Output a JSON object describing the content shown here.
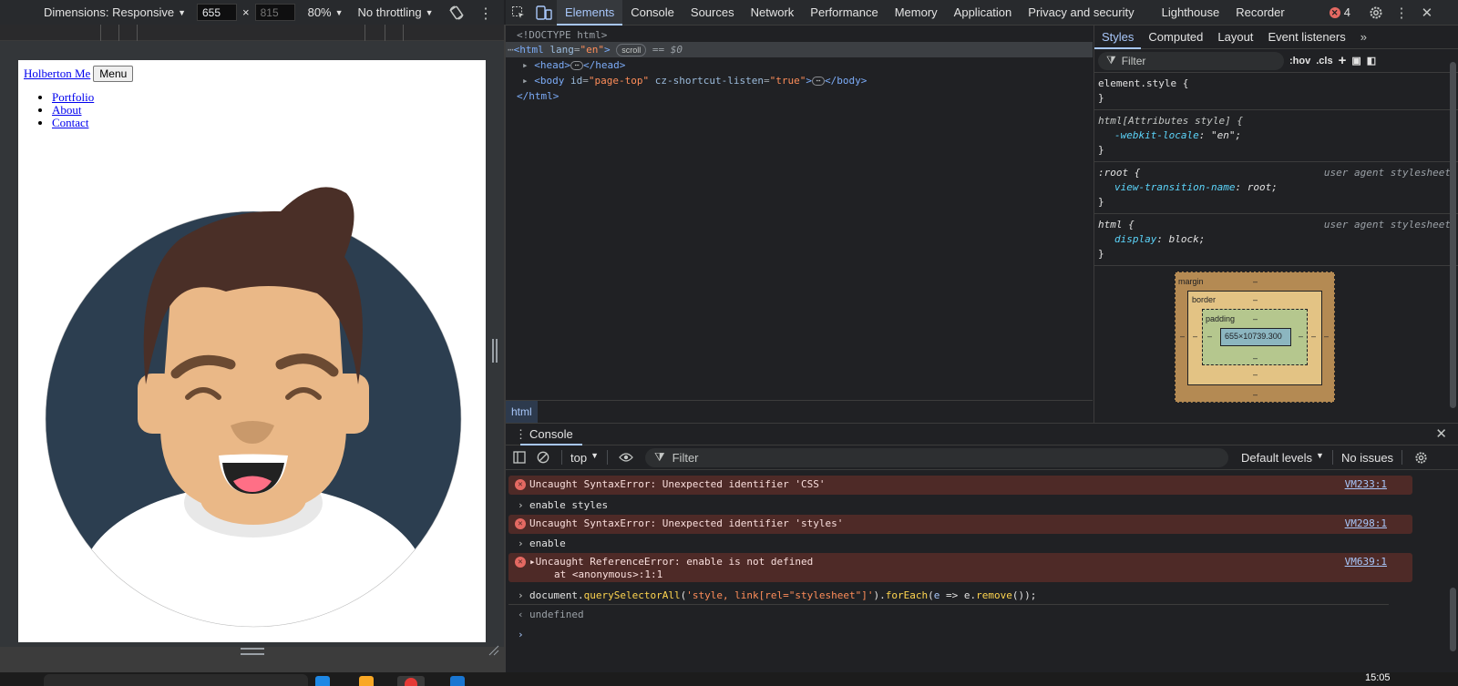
{
  "device_toolbar": {
    "dimensions_label": "Dimensions: Responsive",
    "width": "655",
    "height_placeholder": "815",
    "times": "×",
    "zoom": "80%",
    "throttling": "No throttling"
  },
  "site": {
    "brand_link": "Holberton Me",
    "menu_button": "Menu",
    "nav": [
      "Portfolio",
      "About",
      "Contact"
    ]
  },
  "devtools_tabs": [
    "Elements",
    "Console",
    "Sources",
    "Network",
    "Performance",
    "Memory",
    "Application",
    "Privacy and security",
    "Lighthouse",
    "Recorder"
  ],
  "error_count": "4",
  "elements": {
    "doctype": "<!DOCTYPE html>",
    "html_open_tag": "<html",
    "html_lang_attr": "lang",
    "html_lang_val": "\"en\"",
    "scroll_pill": "scroll",
    "eq_ref": "== $0",
    "head_open": "<head>",
    "head_close": "</head>",
    "body_open": "<body",
    "body_id_attr": "id",
    "body_id_val": "\"page-top\"",
    "body_cz_attr": "cz-shortcut-listen",
    "body_cz_val": "\"true\"",
    "body_close": "</body>",
    "html_close": "</html>",
    "breadcrumb": "html"
  },
  "styles_tabs": [
    "Styles",
    "Computed",
    "Layout",
    "Event listeners"
  ],
  "styles_filter_placeholder": "Filter",
  "hov_label": ":hov",
  "cls_label": ".cls",
  "rules": {
    "r1_selector": "element.style {",
    "r2_selector": "html[Attributes style] {",
    "r2_prop": "-webkit-locale",
    "r2_val": "\"en\";",
    "r3_selector": ":root {",
    "r3_source": "user agent stylesheet",
    "r3_prop": "view-transition-name",
    "r3_val": "root;",
    "r4_selector": "html {",
    "r4_source": "user agent stylesheet",
    "r4_prop": "display",
    "r4_val": "block;",
    "close_brace": "}"
  },
  "box_model": {
    "margin_label": "margin",
    "border_label": "border",
    "padding_label": "padding",
    "dash": "–",
    "content_size": "655×10739.300"
  },
  "drawer": {
    "tab": "Console",
    "context": "top",
    "filter_placeholder": "Filter",
    "levels": "Default levels",
    "issues": "No issues"
  },
  "console": {
    "e1_msg": "Uncaught SyntaxError: Unexpected identifier 'CSS'",
    "e1_src": "VM233:1",
    "in1": "enable styles",
    "e2_msg": "Uncaught SyntaxError: Unexpected identifier 'styles'",
    "e2_src": "VM298:1",
    "in2": "enable",
    "e3_msg": "Uncaught ReferenceError: enable is not defined",
    "e3_sub": "at <anonymous>:1:1",
    "e3_src": "VM639:1",
    "cmd_a": "document.",
    "cmd_b": "querySelectorAll",
    "cmd_c": "(",
    "cmd_d": "'style, link[rel=\"stylesheet\"]'",
    "cmd_e": ").",
    "cmd_f": "forEach",
    "cmd_g": "(",
    "cmd_h": "e",
    "cmd_i": " => e.",
    "cmd_j": "remove",
    "cmd_k": "());",
    "result": "undefined"
  },
  "taskbar": {
    "clock": "15:05"
  },
  "colors": {
    "accent": "#a8c7fa",
    "error": "#e46962",
    "avatar_bg": "#2c3e50",
    "hair": "#4a2f27",
    "skin": "#eab887"
  }
}
